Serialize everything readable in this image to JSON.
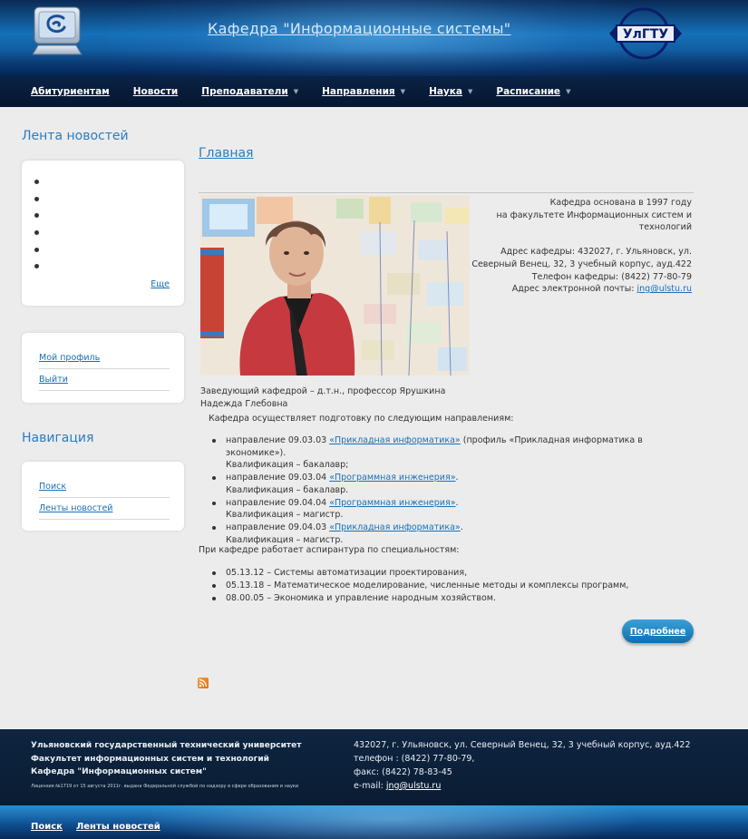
{
  "header": {
    "site_title": "Кафедра \"Информационные системы\"",
    "univ_logo_text": "УлГТУ"
  },
  "nav": [
    {
      "label": "Абитуриентам",
      "has_dropdown": false
    },
    {
      "label": "Новости",
      "has_dropdown": false
    },
    {
      "label": "Преподаватели",
      "has_dropdown": true
    },
    {
      "label": "Направления",
      "has_dropdown": true
    },
    {
      "label": "Наука",
      "has_dropdown": true
    },
    {
      "label": "Расписание",
      "has_dropdown": true
    }
  ],
  "sidebar": {
    "news_heading": "Лента новостей",
    "news_more": "Еще",
    "profile_links": [
      "Мой профиль",
      "Выйти"
    ],
    "navigation_heading": "Навигация",
    "navigation_links": [
      "Поиск",
      "Ленты новостей"
    ]
  },
  "main": {
    "title": "Главная",
    "info_lines": [
      "Кафедра основана в 1997 году",
      "на факультете Информационных систем и технологий",
      "",
      "Адрес кафедры: 432027, г. Ульяновск, ул. Северный Венец, 32, 3 учебный корпус, ауд.422",
      "Телефон кафедры: (8422) 77-80-79",
      "Адрес электронной почты: "
    ],
    "email": "jng@ulstu.ru",
    "caption_line1": "Заведующий кафедрой – д.т.н., профессор Ярушкина",
    "caption_line2": "Надежда Глебовна",
    "intro": "Кафедра осуществляет подготовку по следующим направлениям:",
    "directions": [
      {
        "prefix": "направление 09.03.03 ",
        "link": "«Прикладная информатика»",
        "suffix": "  (профиль «Прикладная информатика в экономике»).",
        "qual": "Квалификация – бакалавр;"
      },
      {
        "prefix": "направление 09.03.04 ",
        "link": "«Программная инженерия»",
        "suffix": ".",
        "qual": "Квалификация – бакалавр."
      },
      {
        "prefix": "направление 09.04.04 ",
        "link": "«Программная инженерия»",
        "suffix": ".",
        "qual": "Квалификация – магистр."
      },
      {
        "prefix": "направление 09.04.03 ",
        "link": "«Прикладная информатика»",
        "suffix": ".",
        "qual": "Квалификация – магистр."
      }
    ],
    "asp_intro": "При кафедре работает аспирантура по специальностям:",
    "asp_items": [
      "05.13.12 – Системы автоматизации проектирования,",
      "05.13.18 – Математическое моделирование, численные методы и комплексы программ,",
      "08.00.05 – Экономика и управление народным хозяйством."
    ],
    "more_button": "Подробнее"
  },
  "footer": {
    "org_lines": [
      "Ульяновский государственный технический университет",
      "Факультет информационных систем и технологий",
      "Кафедра \"Информационных систем\""
    ],
    "license": "Лицензия №1719 от 15 августа 2011г. выдана Федеральной службой по надзору в сфере образования и науки",
    "address": "432027, г. Ульяновск, ул. Северный Венец, 32, 3 учебный корпус, ауд.422",
    "phone": "телефон : (8422) 77-80-79,",
    "fax": "факс: (8422) 78-83-45",
    "email_label": "e-mail: ",
    "email": "jng@ulstu.ru",
    "bottom_links": [
      "Поиск",
      "Ленты новостей"
    ]
  },
  "colors": {
    "accent": "#2a7cc0",
    "nav_bg": "#0b2347",
    "footer_bg": "#0e2540",
    "button": "#1a7fc0"
  }
}
